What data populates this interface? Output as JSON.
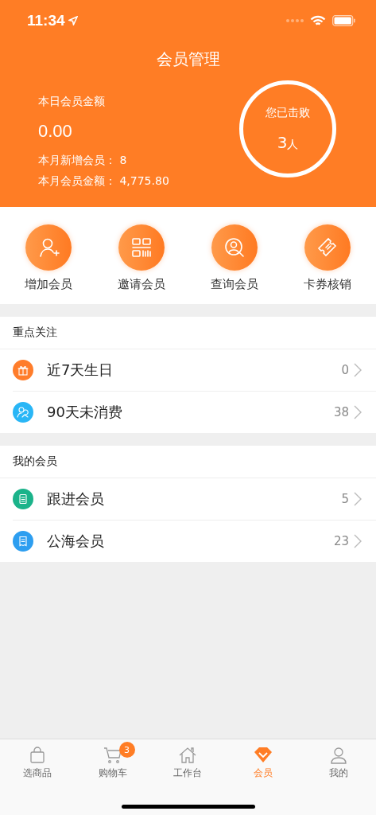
{
  "status_bar": {
    "time": "11:34"
  },
  "header": {
    "title": "会员管理",
    "today_label": "本日会员金额",
    "today_value": "0.00",
    "month_new": "本月新增会员：  8",
    "month_amount": "本月会员金额：  4,775.80",
    "circle_label": "您已击败",
    "circle_value": "3",
    "circle_unit": "人"
  },
  "actions": [
    {
      "label": "增加会员"
    },
    {
      "label": "邀请会员"
    },
    {
      "label": "查询会员"
    },
    {
      "label": "卡券核销"
    }
  ],
  "sections": [
    {
      "title": "重点关注",
      "items": [
        {
          "label": "近7天生日",
          "count": "0",
          "color": "#ff7d2b"
        },
        {
          "label": "90天未消费",
          "count": "38",
          "color": "#29b6f6"
        }
      ]
    },
    {
      "title": "我的会员",
      "items": [
        {
          "label": "跟进会员",
          "count": "5",
          "color": "#1bb38a"
        },
        {
          "label": "公海会员",
          "count": "23",
          "color": "#2d9ef0"
        }
      ]
    }
  ],
  "tab_bar": [
    {
      "label": "选商品",
      "selected": false
    },
    {
      "label": "购物车",
      "selected": false,
      "badge": "3"
    },
    {
      "label": "工作台",
      "selected": false
    },
    {
      "label": "会员",
      "selected": true
    },
    {
      "label": "我的",
      "selected": false
    }
  ]
}
